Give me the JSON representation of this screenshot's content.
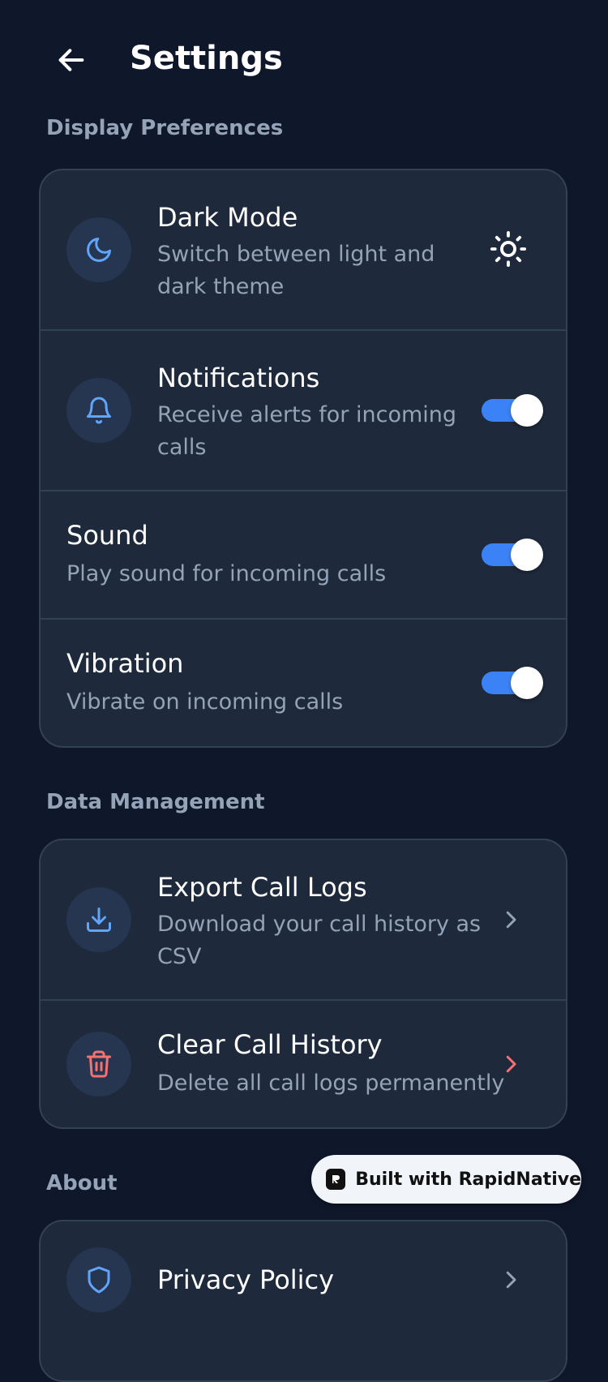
{
  "header": {
    "back_icon": "arrow-left-icon",
    "title": "Settings"
  },
  "sections": {
    "display": {
      "title": "Display Preferences",
      "items": [
        {
          "title": "Dark Mode",
          "subtitle": "Switch between light and dark theme",
          "icon": "moon-icon",
          "control": "sun-icon"
        },
        {
          "title": "Notifications",
          "subtitle": "Receive alerts for incoming calls",
          "icon": "bell-icon",
          "enabled": true
        },
        {
          "title": "Sound",
          "subtitle": "Play sound for incoming calls",
          "enabled": true
        },
        {
          "title": "Vibration",
          "subtitle": "Vibrate on incoming calls",
          "enabled": true
        }
      ]
    },
    "data": {
      "title": "Data Management",
      "items": [
        {
          "title": "Export Call Logs",
          "subtitle": "Download your call history as CSV",
          "icon": "download-icon"
        },
        {
          "title": "Clear Call History",
          "subtitle": "Delete all call logs permanently",
          "icon": "trash-icon"
        }
      ]
    },
    "about": {
      "title": "About",
      "items": [
        {
          "title": "Privacy Policy",
          "icon": "shield-icon"
        }
      ]
    }
  },
  "badge": {
    "label": "Built with RapidNative"
  },
  "colors": {
    "background": "#0f172a",
    "card": "#1e293b",
    "accent": "#3b82f6",
    "danger": "#f87171",
    "muted": "#94a3b8"
  }
}
